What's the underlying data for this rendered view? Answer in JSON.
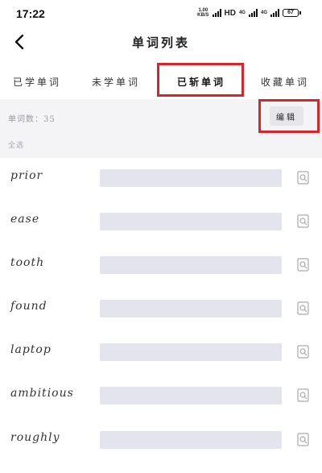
{
  "status_bar": {
    "time": "17:22",
    "net_speed_value": "1.00",
    "net_speed_unit": "KB/S",
    "hd": "HD",
    "net_4g": "4G",
    "net_4g2": "4G",
    "battery": "67"
  },
  "header": {
    "title": "单词列表"
  },
  "tabs": [
    {
      "label": "已学单词",
      "active": false
    },
    {
      "label": "未学单词",
      "active": false
    },
    {
      "label": "已斩单词",
      "active": true
    },
    {
      "label": "收藏单词",
      "active": false
    }
  ],
  "info": {
    "word_count": "单词数：35",
    "select_all": "全选",
    "edit_label": "编辑"
  },
  "words": [
    {
      "word": "prior"
    },
    {
      "word": "ease"
    },
    {
      "word": "tooth"
    },
    {
      "word": "found"
    },
    {
      "word": "laptop"
    },
    {
      "word": "ambitious"
    },
    {
      "word": "roughly"
    }
  ],
  "colors": {
    "highlight": "#d6262c",
    "meaning_bar": "#e4e4ec",
    "band": "#f4f4f7"
  }
}
